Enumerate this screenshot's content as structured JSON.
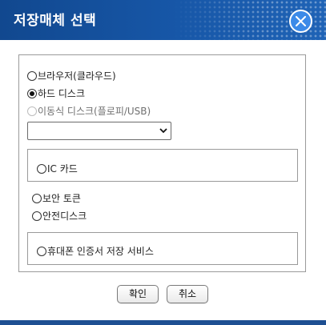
{
  "dialog": {
    "title": "저장매체 선택"
  },
  "options": {
    "browser": "브라우저(클라우드)",
    "harddisk": "하드 디스크",
    "removable": "이동식 디스크(플로피/USB)",
    "ic_card": "IC 카드",
    "security_token": "보안 토큰",
    "safe_disk": "안전디스크",
    "mobile_service": "휴대폰 인증서 저장 서비스"
  },
  "drive_select": {
    "selected": ""
  },
  "buttons": {
    "ok": "확인",
    "cancel": "취소"
  },
  "colors": {
    "titlebar": "#1757a8",
    "close_button": "#3b8ae8"
  },
  "icons": {
    "close": "close-icon",
    "dropdown": "chevron-down-icon"
  }
}
